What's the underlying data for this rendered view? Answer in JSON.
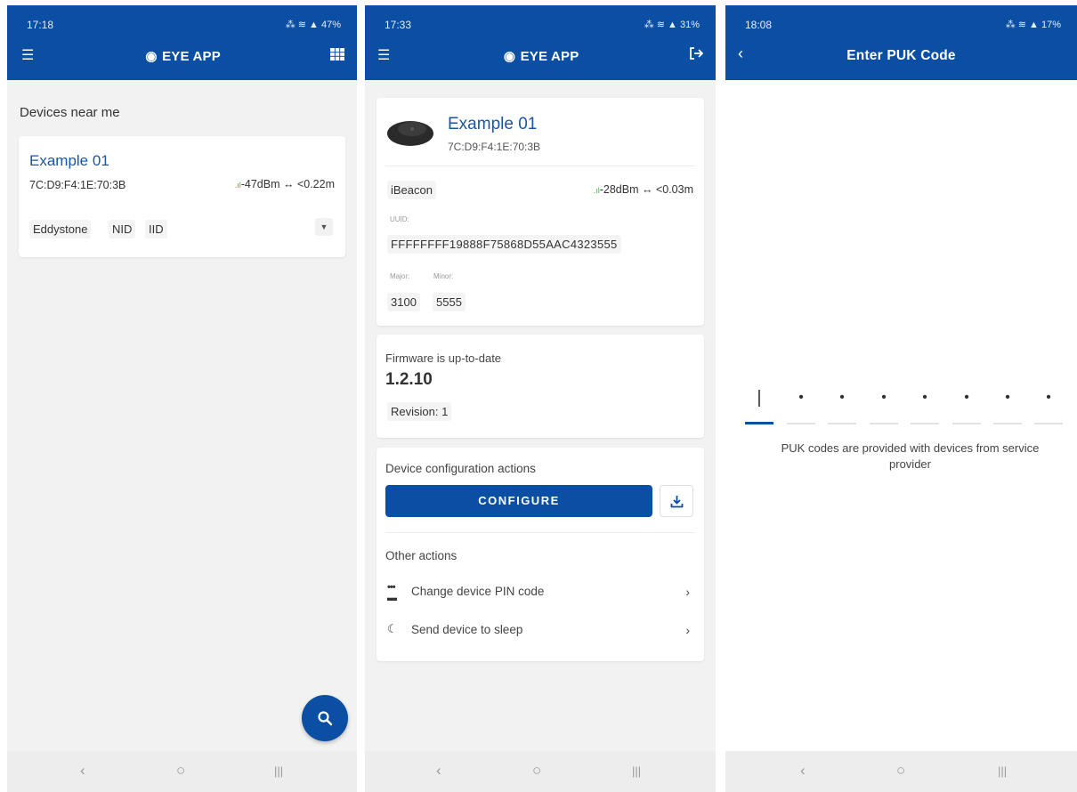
{
  "screen1": {
    "status_time": "17:18",
    "status_right": "⁂ ≋ ▲ 47%",
    "app_title": "EYE APP",
    "icons": {
      "menu": "hamburger-icon",
      "grid": "grid-icon",
      "logo": "eye-logo-icon"
    },
    "section_title": "Devices near me",
    "device": {
      "name": "Example 01",
      "mac": "7C:D9:F4:1E:70:3B",
      "signal": "-47dBm ↔ <0.22m",
      "tags": [
        "Eddystone",
        "NID",
        "IID"
      ]
    },
    "fab_icon": "search-icon"
  },
  "screen2": {
    "status_time": "17:33",
    "status_right": "⁂ ≋ ▲ 31%",
    "app_title": "EYE APP",
    "device": {
      "name": "Example 01",
      "mac": "7C:D9:F4:1E:70:3B",
      "type": "iBeacon",
      "signal": "-28dBm ↔ <0.03m",
      "uuid_label": "UUID:",
      "uuid": "FFFFFFFF19888F75868D55AAC4323555",
      "major_label": "Major:",
      "minor_label": "Minor:",
      "major": "3100",
      "minor": "5555"
    },
    "firmware": {
      "status": "Firmware is up-to-date",
      "version": "1.2.10",
      "revision": "Revision: 1"
    },
    "config": {
      "title": "Device configuration actions",
      "configure_label": "CONFIGURE",
      "other_title": "Other actions",
      "actions": [
        "Change device PIN code",
        "Send device to sleep"
      ]
    }
  },
  "screen3": {
    "status_time": "18:08",
    "status_right": "⁂ ≋ ▲ 17%",
    "title": "Enter PUK Code",
    "hint": "PUK codes are provided with devices from service provider",
    "digits": [
      "|",
      "•",
      "•",
      "•",
      "•",
      "•",
      "•",
      "•"
    ]
  },
  "nav": {
    "back": "‹",
    "home": "○",
    "recents": "|||"
  },
  "colors": {
    "primary": "#0a4fa3",
    "link": "#1a56a6",
    "signal": "#4caf50",
    "background": "#f2f2f2"
  }
}
